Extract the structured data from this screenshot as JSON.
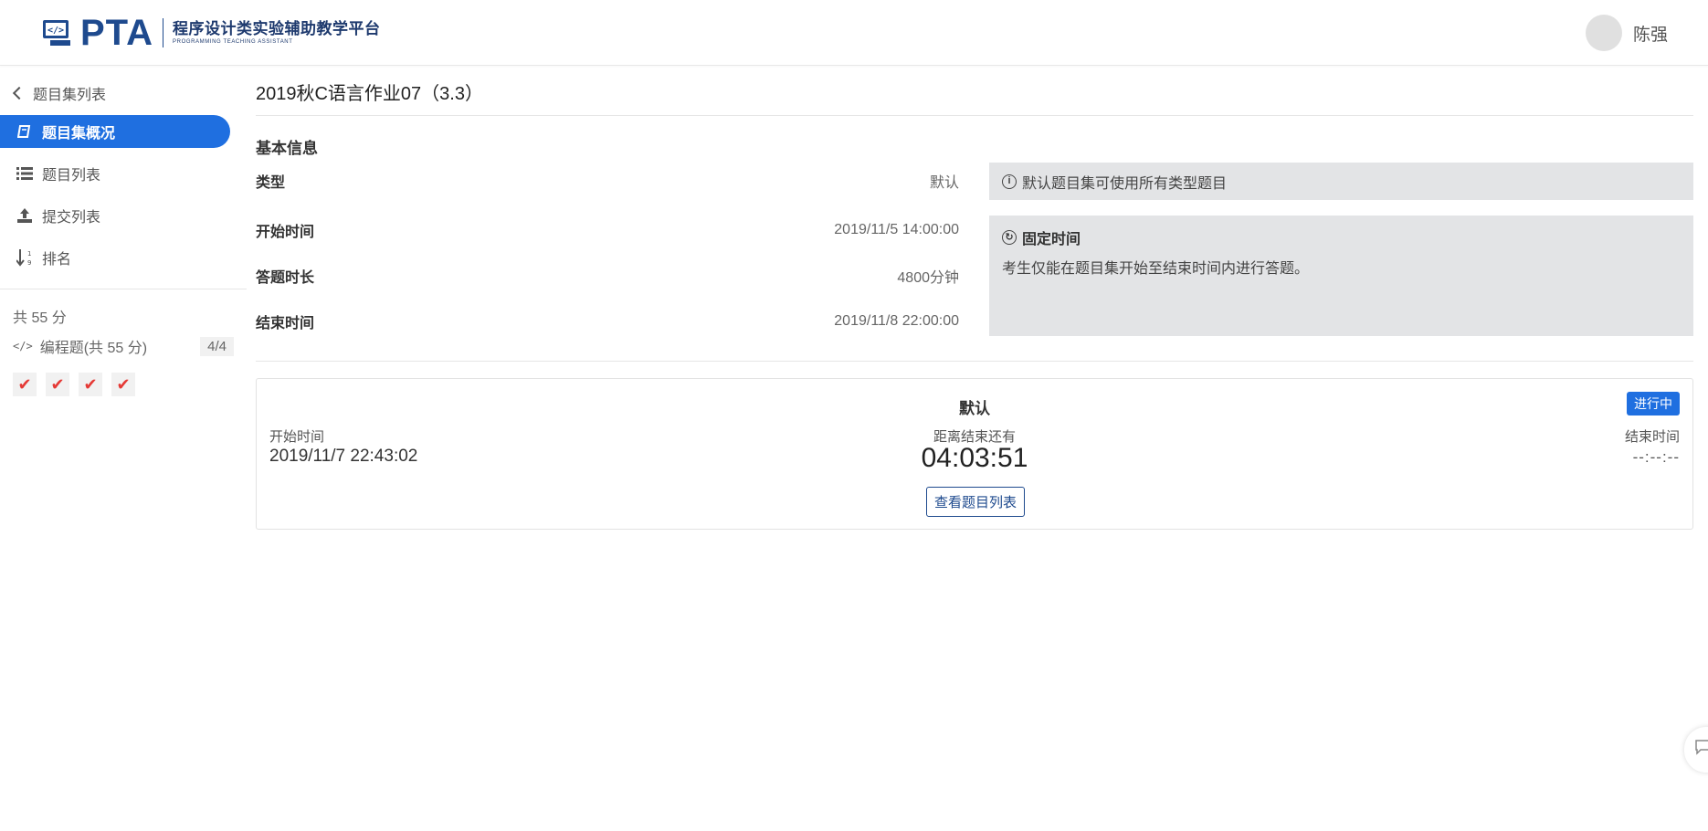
{
  "header": {
    "logo_text": "PTA",
    "logo_subtitle_cn": "程序设计类实验辅助教学平台",
    "logo_subtitle_en": "PROGRAMMING TEACHING ASSISTANT",
    "user_name": "陈强"
  },
  "sidebar": {
    "back_label": "题目集列表",
    "items": [
      {
        "label": "题目集概况",
        "icon": "book-icon",
        "active": true
      },
      {
        "label": "题目列表",
        "icon": "list-icon",
        "active": false
      },
      {
        "label": "提交列表",
        "icon": "upload-icon",
        "active": false
      },
      {
        "label": "排名",
        "icon": "sort-icon",
        "active": false
      }
    ],
    "total_score": "共 55 分",
    "category": {
      "label": "编程题(共 55 分)",
      "icon": "code-icon",
      "count": "4/4"
    },
    "check_count": 4,
    "check_color": "#e53935"
  },
  "main": {
    "title": "2019秋C语言作业07（3.3）",
    "section_title": "基本信息",
    "info": {
      "type_label": "类型",
      "type_value": "默认",
      "start_label": "开始时间",
      "start_value": "2019/11/5 14:00:00",
      "duration_label": "答题时长",
      "duration_value": "4800分钟",
      "end_label": "结束时间",
      "end_value": "2019/11/8 22:00:00"
    },
    "note_type": "默认题目集可使用所有类型题目",
    "note_fixed_title": "固定时间",
    "note_fixed_text": "考生仅能在题目集开始至结束时间内进行答题。",
    "card": {
      "title": "默认",
      "badge": "进行中",
      "start_label": "开始时间",
      "start_value": "2019/11/7 22:43:02",
      "remaining_label": "距离结束还有",
      "remaining_value": "04:03:51",
      "end_label": "结束时间",
      "end_value": "--:--:--",
      "button_label": "查看题目列表"
    }
  },
  "colors": {
    "primary": "#1f6fe0",
    "brand": "#1e4a8e",
    "note_bg": "#e3e4e6"
  }
}
